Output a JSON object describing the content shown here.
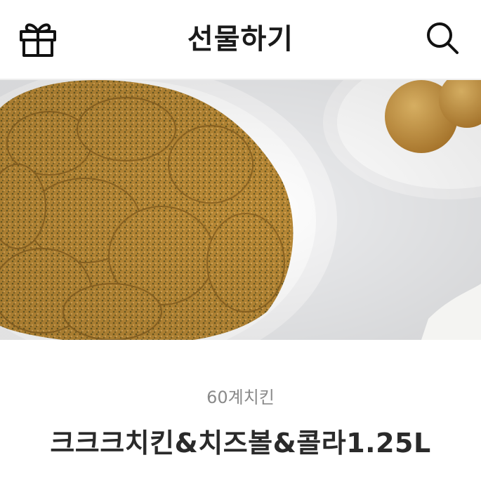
{
  "header": {
    "title": "선물하기",
    "left_icon": "gift-icon",
    "right_icon": "search-icon"
  },
  "hero": {
    "image": "fried-chicken-photo"
  },
  "product": {
    "brand": "60계치킨",
    "name": "크크크치킨&치즈볼&콜라1.25L"
  },
  "colors": {
    "title_text": "#1a1a1a",
    "brand_text": "#8a8a8a",
    "name_text": "#2a2a2a",
    "chicken": "#b98a3a"
  }
}
